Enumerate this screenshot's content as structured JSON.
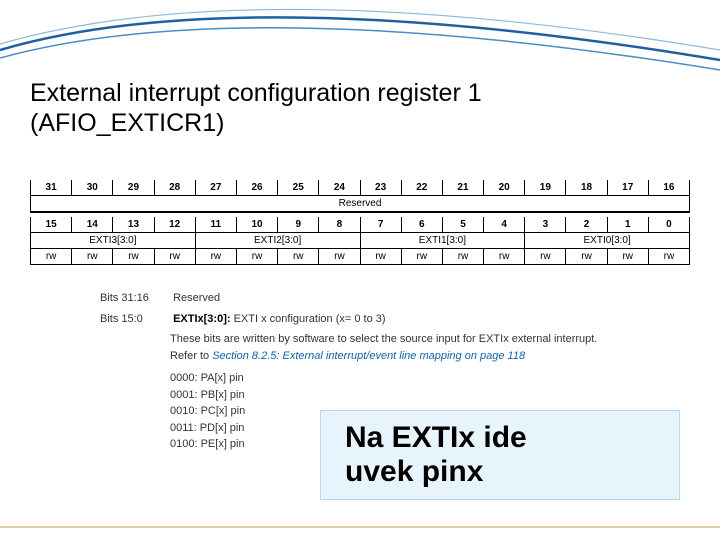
{
  "title_line1": "External interrupt configuration register 1",
  "title_line2": "(AFIO_EXTICR1)",
  "bits_high": [
    "31",
    "30",
    "29",
    "28",
    "27",
    "26",
    "25",
    "24",
    "23",
    "22",
    "21",
    "20",
    "19",
    "18",
    "17",
    "16"
  ],
  "reserved_label": "Reserved",
  "bits_low": [
    "15",
    "14",
    "13",
    "12",
    "11",
    "10",
    "9",
    "8",
    "7",
    "6",
    "5",
    "4",
    "3",
    "2",
    "1",
    "0"
  ],
  "exti_fields": [
    "EXTI3[3:0]",
    "EXTI2[3:0]",
    "EXTI1[3:0]",
    "EXTI0[3:0]"
  ],
  "rw": [
    "rw",
    "rw",
    "rw",
    "rw",
    "rw",
    "rw",
    "rw",
    "rw",
    "rw",
    "rw",
    "rw",
    "rw",
    "rw",
    "rw",
    "rw",
    "rw"
  ],
  "desc": {
    "b1_label": "Bits 31:16",
    "b1_text": "Reserved",
    "b2_label": "Bits 15:0",
    "b2_bold": "EXTIx[3:0]:",
    "b2_text": " EXTI x configuration (x= 0 to 3)",
    "body1": "These bits are written by software to select the source input for EXTIx external interrupt.",
    "body2_pre": "Refer to ",
    "body2_ref": "Section 8.2.5: External interrupt/event line mapping on page 118",
    "p0": "0000: PA[x] pin",
    "p1": "0001: PB[x] pin",
    "p2": "0010: PC[x] pin",
    "p3": "0011: PD[x] pin",
    "p4": "0100: PE[x] pin"
  },
  "callout_l1": "Na EXTIx ide",
  "callout_l2": "uvek pinx"
}
